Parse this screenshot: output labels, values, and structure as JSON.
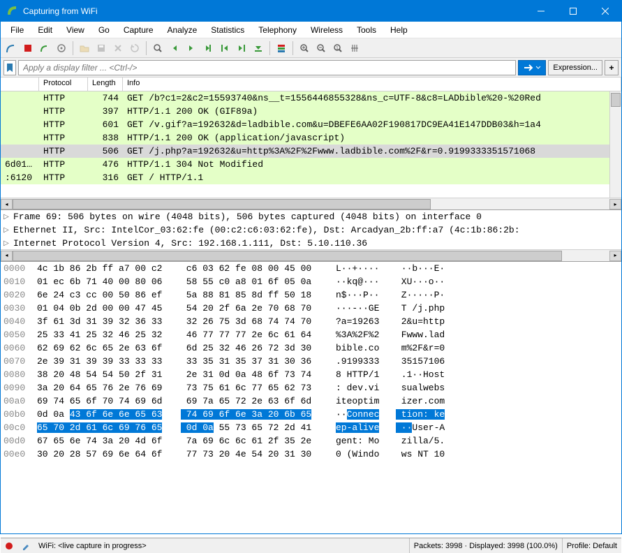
{
  "title": "Capturing from WiFi",
  "menu": [
    "File",
    "Edit",
    "View",
    "Go",
    "Capture",
    "Analyze",
    "Statistics",
    "Telephony",
    "Wireless",
    "Tools",
    "Help"
  ],
  "filter_placeholder": "Apply a display filter ... <Ctrl-/>",
  "expression_label": "Expression...",
  "columns": {
    "protocol": "Protocol",
    "length": "Length",
    "info": "Info"
  },
  "packets": [
    {
      "src": "",
      "proto": "HTTP",
      "len": "744",
      "info": "GET /b?c1=2&c2=15593740&ns__t=1556446855328&ns_c=UTF-8&c8=LADbible%20-%20Red",
      "cls": "green"
    },
    {
      "src": "",
      "proto": "HTTP",
      "len": "397",
      "info": "HTTP/1.1 200 OK  (GIF89a)",
      "cls": "green"
    },
    {
      "src": "",
      "proto": "HTTP",
      "len": "601",
      "info": "GET /v.gif?a=192632&d=ladbible.com&u=DBEFE6AA02F190817DC9EA41E147DDB03&h=1a4",
      "cls": "green"
    },
    {
      "src": "",
      "proto": "HTTP",
      "len": "838",
      "info": "HTTP/1.1 200 OK  (application/javascript)",
      "cls": "green"
    },
    {
      "src": "",
      "proto": "HTTP",
      "len": "506",
      "info": "GET /j.php?a=192632&u=http%3A%2F%2Fwww.ladbible.com%2F&r=0.9199333351571068",
      "cls": "selected"
    },
    {
      "src": "6d01…",
      "proto": "HTTP",
      "len": "476",
      "info": "HTTP/1.1 304 Not Modified",
      "cls": "green"
    },
    {
      "src": ":6120",
      "proto": "HTTP",
      "len": "316",
      "info": "GET / HTTP/1.1",
      "cls": "green"
    }
  ],
  "details": [
    "Frame 69: 506 bytes on wire (4048 bits), 506 bytes captured (4048 bits) on interface 0",
    "Ethernet II, Src: IntelCor_03:62:fe (00:c2:c6:03:62:fe), Dst: Arcadyan_2b:ff:a7 (4c:1b:86:2b:",
    "Internet Protocol Version 4, Src: 192.168.1.111, Dst: 5.10.110.36"
  ],
  "hex": [
    {
      "off": "0000",
      "b1": "4c 1b 86 2b ff a7 00 c2",
      "b2": " c6 03 62 fe 08 00 45 00",
      "a1": "L··+····",
      "a2": " ··b···E·"
    },
    {
      "off": "0010",
      "b1": "01 ec 6b 71 40 00 80 06",
      "b2": " 58 55 c0 a8 01 6f 05 0a",
      "a1": "··kq@···",
      "a2": " XU···o··"
    },
    {
      "off": "0020",
      "b1": "6e 24 c3 cc 00 50 86 ef",
      "b2": " 5a 88 81 85 8d ff 50 18",
      "a1": "n$···P··",
      "a2": " Z·····P·"
    },
    {
      "off": "0030",
      "b1": "01 04 0b 2d 00 00 47 45",
      "b2": " 54 20 2f 6a 2e 70 68 70",
      "a1": "···-··GE",
      "a2": " T /j.php"
    },
    {
      "off": "0040",
      "b1": "3f 61 3d 31 39 32 36 33",
      "b2": " 32 26 75 3d 68 74 74 70",
      "a1": "?a=19263",
      "a2": " 2&u=http"
    },
    {
      "off": "0050",
      "b1": "25 33 41 25 32 46 25 32",
      "b2": " 46 77 77 77 2e 6c 61 64",
      "a1": "%3A%2F%2",
      "a2": " Fwww.lad"
    },
    {
      "off": "0060",
      "b1": "62 69 62 6c 65 2e 63 6f",
      "b2": " 6d 25 32 46 26 72 3d 30",
      "a1": "bible.co",
      "a2": " m%2F&r=0"
    },
    {
      "off": "0070",
      "b1": "2e 39 31 39 39 33 33 33",
      "b2": " 33 35 31 35 37 31 30 36",
      "a1": ".9199333",
      "a2": " 35157106"
    },
    {
      "off": "0080",
      "b1": "38 20 48 54 54 50 2f 31",
      "b2": " 2e 31 0d 0a 48 6f 73 74",
      "a1": "8 HTTP/1",
      "a2": " .1··Host"
    },
    {
      "off": "0090",
      "b1": "3a 20 64 65 76 2e 76 69",
      "b2": " 73 75 61 6c 77 65 62 73",
      "a1": ": dev.vi",
      "a2": " sualwebs"
    },
    {
      "off": "00a0",
      "b1": "69 74 65 6f 70 74 69 6d",
      "b2": " 69 7a 65 72 2e 63 6f 6d",
      "a1": "iteoptim",
      "a2": " izer.com"
    },
    {
      "off": "00b0",
      "b1": "0d 0a ",
      "hb1": "43 6f 6e 6e 65 63",
      "b2": " 74 69 6f 6e 3a 20 6b 65",
      "a1": "··",
      "ha1": "Connec",
      "a2": " tion: ke",
      "hla2": true
    },
    {
      "off": "00c0",
      "hb1f": "65 70 2d 61 6c 69 76 65",
      "b2_hl": " 0d 0a",
      "b2": " 55 73 65 72 2d 41",
      "ha1f": "ep-alive",
      "a2_hl": " ··",
      "a2": "User-A"
    },
    {
      "off": "00d0",
      "b1": "67 65 6e 74 3a 20 4d 6f",
      "b2": " 7a 69 6c 6c 61 2f 35 2e",
      "a1": "gent: Mo",
      "a2": " zilla/5."
    },
    {
      "off": "00e0",
      "b1": "30 20 28 57 69 6e 64 6f",
      "b2": " 77 73 20 4e 54 20 31 30",
      "a1": "0 (Windo",
      "a2": " ws NT 10"
    }
  ],
  "status": {
    "capture": "WiFi: <live capture in progress>",
    "packets": "Packets: 3998 · Displayed: 3998 (100.0%)",
    "profile": "Profile: Default"
  }
}
